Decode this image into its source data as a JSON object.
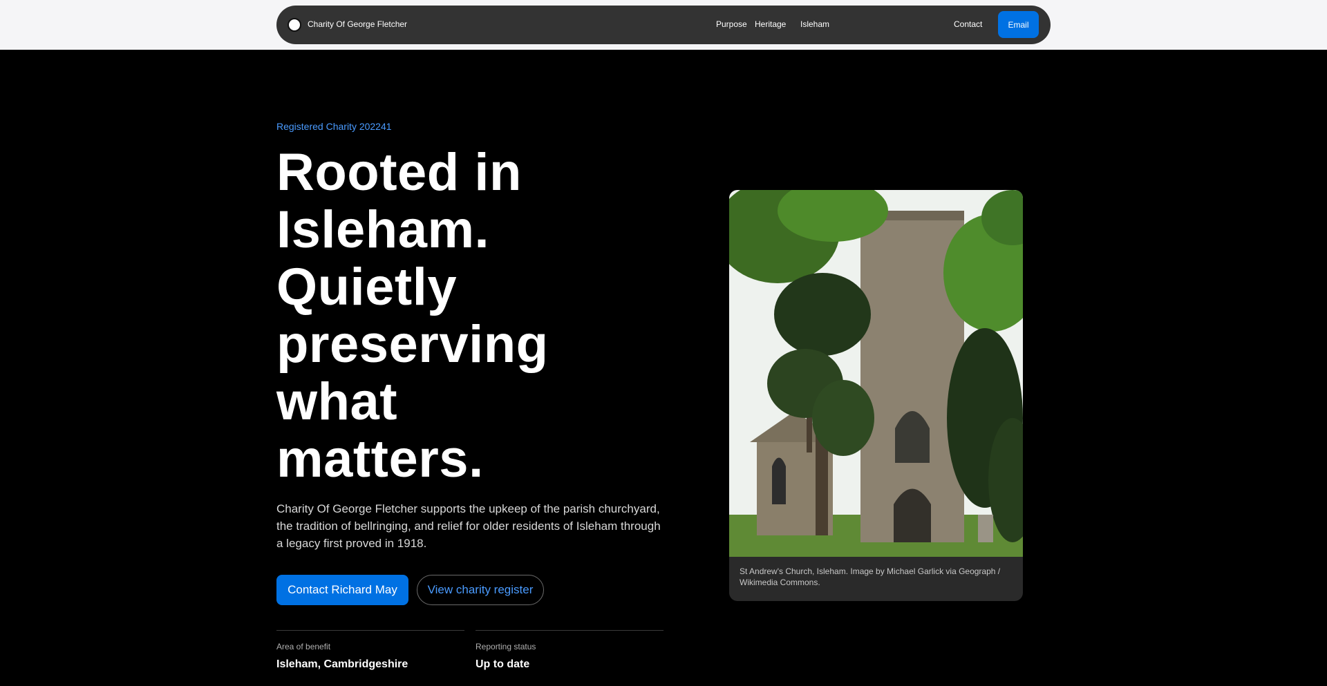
{
  "nav": {
    "brand": "Charity Of George Fletcher",
    "links": [
      "Purpose",
      "Heritage",
      "Isleham",
      "Contact"
    ],
    "email_button": "Email"
  },
  "hero": {
    "eyebrow": "Registered Charity 202241",
    "title_lines": [
      "Rooted in",
      "Isleham.",
      "Quietly",
      "preserving",
      "what",
      "matters."
    ],
    "description": "Charity Of George Fletcher supports the upkeep of the parish churchyard, the tradition of bellringing, and relief for older residents of Isleham through a legacy first proved in 1918.",
    "primary_button": "Contact Richard May",
    "secondary_button": "View charity register"
  },
  "stats": [
    {
      "label": "Area of benefit",
      "value": "Isleham, Cambridgeshire"
    },
    {
      "label": "Reporting status",
      "value": "Up to date"
    }
  ],
  "figure": {
    "alt": "St Andrew's Church, Isleham",
    "caption": "St Andrew's Church, Isleham. Image by Michael Garlick via Geograph / Wikimedia Commons."
  },
  "colors": {
    "accent": "#0071e3",
    "accent_text": "#4a9bff",
    "background": "#000000",
    "nav_background": "#333333"
  }
}
